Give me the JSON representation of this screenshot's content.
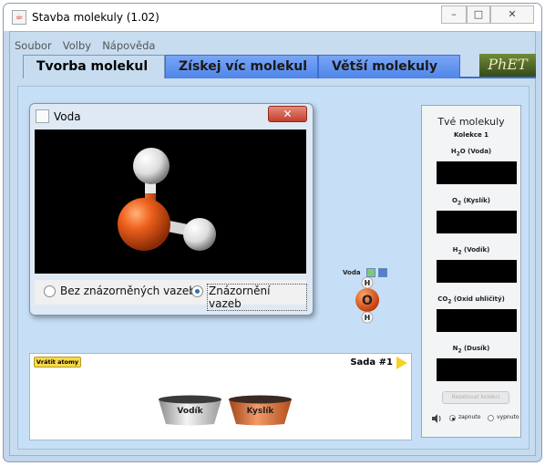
{
  "window": {
    "title": "Stavba molekuly (1.02)"
  },
  "menu": [
    "Soubor",
    "Volby",
    "Nápověda"
  ],
  "tabs": [
    "Tvorba molekul",
    "Získej víc molekul",
    "Větší molekuly"
  ],
  "logo": "PhET",
  "dialog": {
    "title": "Voda",
    "options": [
      "Bez znázorněných vazeb",
      "Znázornění vazeb"
    ],
    "selected": "Znázornění vazeb"
  },
  "built_molecule": {
    "name": "Voda",
    "atoms": [
      "H",
      "O",
      "H"
    ]
  },
  "kit": {
    "return_label": "Vrátit atomy",
    "set_label": "Sada #1",
    "buckets": [
      "Vodík",
      "Kyslík"
    ]
  },
  "collection": {
    "title": "Tvé molekuly",
    "subtitle": "Kolekce 1",
    "goals": [
      {
        "formula_main": "H",
        "sub": "2",
        "formula_rest": "O",
        "name": "(Voda)"
      },
      {
        "formula_main": "O",
        "sub": "2",
        "formula_rest": "",
        "name": "(Kyslík)"
      },
      {
        "formula_main": "H",
        "sub": "2",
        "formula_rest": "",
        "name": "(Vodík)"
      },
      {
        "formula_main": "CO",
        "sub": "2",
        "formula_rest": "",
        "name": "(Oxid uhličitý)"
      },
      {
        "formula_main": "N",
        "sub": "2",
        "formula_rest": "",
        "name": "(Dusík)"
      }
    ],
    "reset_label": "Resetovat kolekci",
    "sound_on": "zapnuto",
    "sound_off": "vypnuto",
    "sound_selected": "zapnuto"
  },
  "colors": {
    "oxygen": "#e8501a",
    "hydrogen": "#ffffff",
    "tab_active": "#c7dcef",
    "tab_inactive": "#5b8ef0",
    "goal_box": "#000000"
  }
}
